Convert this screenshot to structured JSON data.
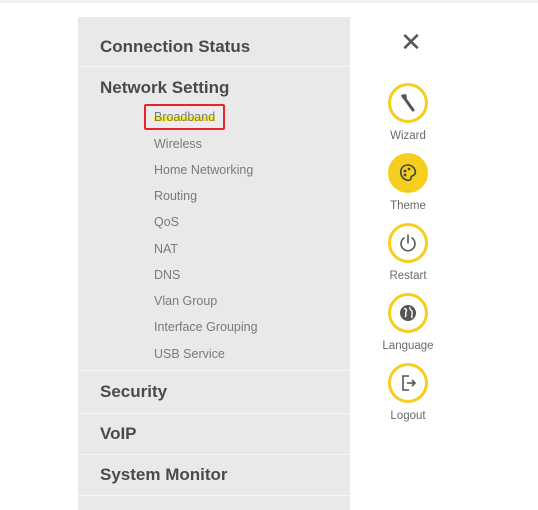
{
  "menu": {
    "sections": {
      "connection_status": "Connection Status",
      "network_setting": "Network Setting",
      "security": "Security",
      "voip": "VoIP",
      "system_monitor": "System Monitor"
    },
    "network_setting_items": [
      "Broadband",
      "Wireless",
      "Home Networking",
      "Routing",
      "QoS",
      "NAT",
      "DNS",
      "Vlan Group",
      "Interface Grouping",
      "USB Service"
    ],
    "active_item": "Broadband"
  },
  "sidebar": {
    "close_glyph": "✕",
    "tools": [
      {
        "label": "Wizard",
        "icon": "wand-icon"
      },
      {
        "label": "Theme",
        "icon": "palette-icon"
      },
      {
        "label": "Restart",
        "icon": "power-icon"
      },
      {
        "label": "Language",
        "icon": "globe-icon"
      },
      {
        "label": "Logout",
        "icon": "logout-icon"
      }
    ]
  },
  "colors": {
    "accent_yellow": "#f6cf1e",
    "highlight_box": "#e8232a",
    "panel_gray": "#e9e9e9"
  }
}
